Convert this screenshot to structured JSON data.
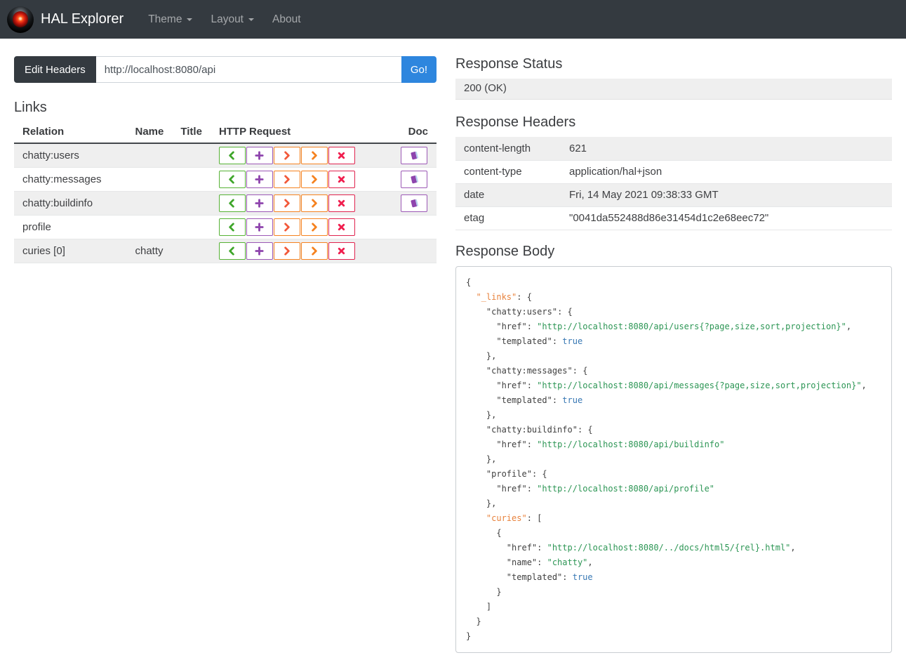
{
  "navbar": {
    "brand": "HAL Explorer",
    "logo_icon": "hal-9000-eye",
    "items": [
      {
        "label": "Theme",
        "dropdown": true
      },
      {
        "label": "Layout",
        "dropdown": true
      },
      {
        "label": "About",
        "dropdown": false
      }
    ]
  },
  "url_bar": {
    "edit_headers_label": "Edit Headers",
    "url_value": "http://localhost:8080/api",
    "go_label": "Go!"
  },
  "links_section": {
    "title": "Links",
    "columns": [
      "Relation",
      "Name",
      "Title",
      "HTTP Request",
      "Doc"
    ],
    "http_buttons": [
      {
        "name": "get",
        "icon": "chevron-left",
        "border": "#56b235",
        "icon_color": "#3fa62a"
      },
      {
        "name": "post",
        "icon": "plus",
        "border": "#9b58b5",
        "icon_color": "#8e44ad"
      },
      {
        "name": "put",
        "icon": "chevron-right",
        "border": "#f5821f",
        "icon_color": "#f2593a"
      },
      {
        "name": "patch",
        "icon": "chevron-right",
        "border": "#f5821f",
        "icon_color": "#f5821f"
      },
      {
        "name": "delete",
        "icon": "x",
        "border": "#e0234e",
        "icon_color": "#f01e4e"
      }
    ],
    "doc_button": {
      "icon": "book",
      "border": "#9b58b5",
      "icon_color": "#8e44ad"
    },
    "rows": [
      {
        "relation": "chatty:users",
        "name": "",
        "title": "",
        "doc": true
      },
      {
        "relation": "chatty:messages",
        "name": "",
        "title": "",
        "doc": true
      },
      {
        "relation": "chatty:buildinfo",
        "name": "",
        "title": "",
        "doc": true
      },
      {
        "relation": "profile",
        "name": "",
        "title": "",
        "doc": false
      },
      {
        "relation": "curies [0]",
        "name": "chatty",
        "title": "",
        "doc": false
      }
    ]
  },
  "response_status": {
    "title": "Response Status",
    "value": "200 (OK)"
  },
  "response_headers": {
    "title": "Response Headers",
    "rows": [
      {
        "name": "content-length",
        "value": "621"
      },
      {
        "name": "content-type",
        "value": "application/hal+json"
      },
      {
        "name": "date",
        "value": "Fri, 14 May 2021 09:38:33 GMT"
      },
      {
        "name": "etag",
        "value": "\"0041da552488d86e31454d1c2e68eec72\""
      }
    ]
  },
  "response_body": {
    "title": "Response Body",
    "special_keys": [
      "_links",
      "curies"
    ],
    "json": {
      "_links": {
        "chatty:users": {
          "href": "http://localhost:8080/api/users{?page,size,sort,projection}",
          "templated": true
        },
        "chatty:messages": {
          "href": "http://localhost:8080/api/messages{?page,size,sort,projection}",
          "templated": true
        },
        "chatty:buildinfo": {
          "href": "http://localhost:8080/api/buildinfo"
        },
        "profile": {
          "href": "http://localhost:8080/api/profile"
        },
        "curies": [
          {
            "href": "http://localhost:8080/../docs/html5/{rel}.html",
            "name": "chatty",
            "templated": true
          }
        ]
      }
    }
  },
  "colors": {
    "navbar_bg": "#343a40",
    "go_button": "#2e86de",
    "stripe": "#efefef",
    "json_key": "#404040",
    "json_rel": "#e8823c",
    "json_string": "#2d9655",
    "json_bool": "#3878b4"
  }
}
